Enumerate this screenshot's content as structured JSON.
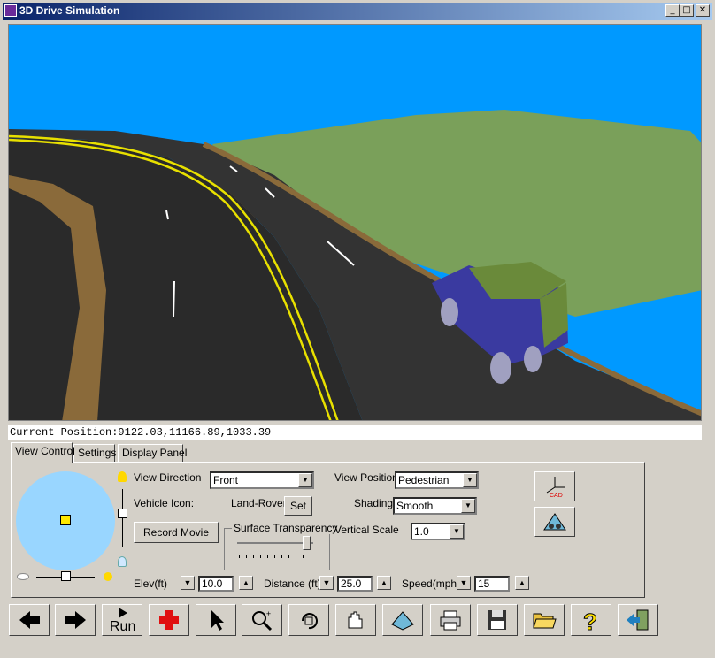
{
  "window": {
    "title": "3D Drive Simulation",
    "minimize_label": "_",
    "maximize_label": "□",
    "close_label": "✕"
  },
  "position_bar": {
    "label": "Current Position:",
    "value": "9122.03,11166.89,1033.39"
  },
  "tabs": [
    {
      "label": "View Control"
    },
    {
      "label": "Settings"
    },
    {
      "label": "Display Panel"
    }
  ],
  "view_control": {
    "view_direction_label": "View Direction",
    "view_direction_value": "Front",
    "view_position_label": "View Position",
    "view_position_value": "Pedestrian",
    "vehicle_icon_label": "Vehicle Icon:",
    "vehicle_icon_value": "Land-Rover",
    "set_label": "Set",
    "shading_label": "Shading",
    "shading_value": "Smooth",
    "record_movie_label": "Record Movie",
    "surface_transparency_label": "Surface Transparency",
    "vertical_scale_label": "Vertical Scale",
    "vertical_scale_value": "1.0",
    "elev_label": "Elev(ft)",
    "elev_value": "10.0",
    "distance_label": "Distance (ft)",
    "distance_value": "25.0",
    "speed_label": "Speed(mph)",
    "speed_value": "15"
  },
  "toolbar": {
    "run_label": "Run"
  },
  "colors": {
    "sky": "#0099ff",
    "terrain": "#7aa05a",
    "road": "#2a2a2a",
    "center_line": "#e8e000",
    "vehicle_body": "#3a3aa0",
    "vehicle_roof": "#6a8a3a",
    "joystick": "#99d6ff"
  }
}
